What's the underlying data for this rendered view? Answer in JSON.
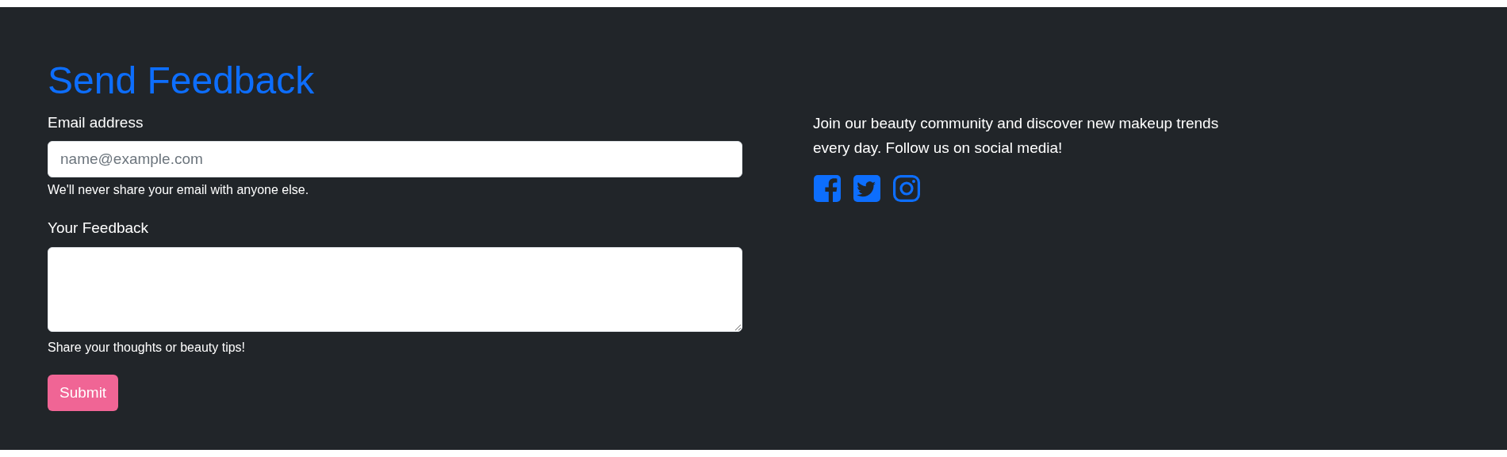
{
  "form": {
    "title": "Send Feedback",
    "email": {
      "label": "Email address",
      "placeholder": "name@example.com",
      "help": "We'll never share your email with anyone else."
    },
    "feedback": {
      "label": "Your Feedback",
      "help": "Share your thoughts or beauty tips!"
    },
    "submit": "Submit"
  },
  "about": {
    "text": "Join our beauty community and discover new makeup trends every day. Follow us on social media!",
    "social_links": [
      {
        "kind": "facebook"
      },
      {
        "kind": "twitter"
      },
      {
        "kind": "instagram"
      }
    ]
  }
}
